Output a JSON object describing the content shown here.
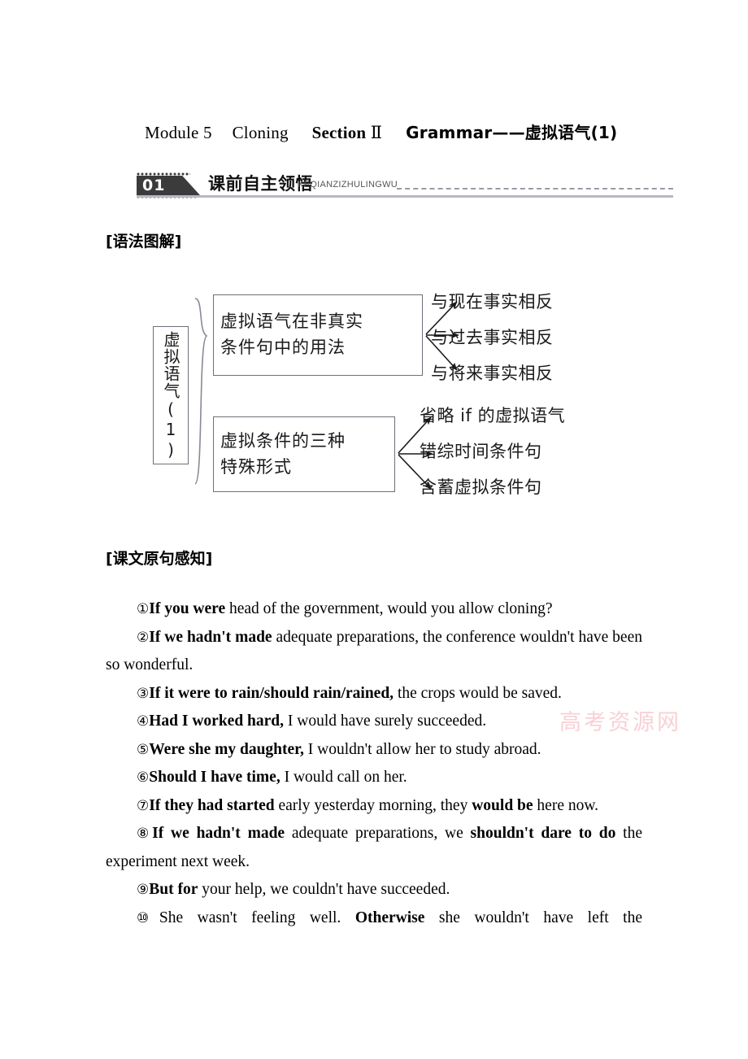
{
  "title": {
    "module": "Module 5",
    "unit": "Cloning",
    "section": "Section",
    "section_numeral": "Ⅱ",
    "topic": "Grammar——虚拟语气(1)"
  },
  "badge": {
    "number": "01",
    "label": "课前自主领悟",
    "pinyin": "KEQIANZIZHULINGWU"
  },
  "headings": {
    "grammar_diagram": "[语法图解]",
    "text_sentences": "[课文原句感知]"
  },
  "diagram": {
    "root": "虚拟语气(1)",
    "box_usage_line1": "虚拟语气在非真实",
    "box_usage_line2": "条件句中的用法",
    "box_forms_line1": "虚拟条件的三种",
    "box_forms_line2": "特殊形式",
    "branches": [
      "与现在事实相反",
      "与过去事实相反",
      "与将来事实相反",
      "省略 if 的虚拟语气",
      "错综时间条件句",
      "含蓄虚拟条件句"
    ]
  },
  "sentences": [
    {
      "num": "①",
      "parts": [
        {
          "text": "If you were",
          "bold": true
        },
        {
          "text": " head of the government, would you allow cloning?",
          "bold": false
        }
      ]
    },
    {
      "num": "②",
      "parts": [
        {
          "text": "If we hadn't made",
          "bold": true
        },
        {
          "text": " adequate preparations, the conference wouldn't have been so wonderful.",
          "bold": false
        }
      ]
    },
    {
      "num": "③",
      "parts": [
        {
          "text": "If it were to rain/should rain/rained,",
          "bold": true
        },
        {
          "text": " the crops would be saved.",
          "bold": false
        }
      ]
    },
    {
      "num": "④",
      "parts": [
        {
          "text": "Had I worked hard,",
          "bold": true
        },
        {
          "text": " I would have surely succeeded.",
          "bold": false
        }
      ]
    },
    {
      "num": "⑤",
      "parts": [
        {
          "text": "Were she my daughter,",
          "bold": true
        },
        {
          "text": " I wouldn't allow her to study abroad.",
          "bold": false
        }
      ]
    },
    {
      "num": "⑥",
      "parts": [
        {
          "text": "Should I have time,",
          "bold": true
        },
        {
          "text": " I would call on her.",
          "bold": false
        }
      ]
    },
    {
      "num": "⑦",
      "parts": [
        {
          "text": "If they had started",
          "bold": true
        },
        {
          "text": " early yesterday morning, they ",
          "bold": false
        },
        {
          "text": "would be",
          "bold": true
        },
        {
          "text": " here now.",
          "bold": false
        }
      ]
    },
    {
      "num": "⑧",
      "parts": [
        {
          "text": "If we hadn't made",
          "bold": true
        },
        {
          "text": " adequate preparations, we ",
          "bold": false
        },
        {
          "text": "shouldn't dare to do",
          "bold": true
        },
        {
          "text": " the experiment next week.",
          "bold": false
        }
      ]
    },
    {
      "num": "⑨",
      "parts": [
        {
          "text": "But for",
          "bold": true
        },
        {
          "text": " your help, we couldn't have succeeded.",
          "bold": false
        }
      ]
    },
    {
      "num": "⑩",
      "parts": [
        {
          "text": "She wasn't feeling well. ",
          "bold": false
        },
        {
          "text": "Otherwise",
          "bold": true
        },
        {
          "text": " she wouldn't have left the",
          "bold": false
        }
      ]
    }
  ],
  "watermark": "高考资源网"
}
